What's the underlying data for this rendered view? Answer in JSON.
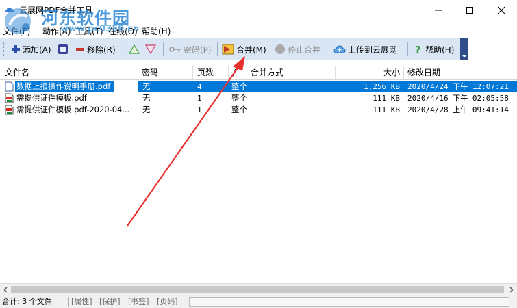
{
  "window": {
    "title": "云展网PDF合并工具"
  },
  "watermark": {
    "text": "河东软件园",
    "url": "www.pc0359.cn"
  },
  "menu": {
    "items": [
      "文件(F)",
      "动作(A)",
      "工具(T)",
      "在线(O)",
      "帮助(H)"
    ]
  },
  "toolbar": {
    "add": "添加(A)",
    "remove": "移除(R)",
    "password": "密码(P)",
    "merge": "合并(M)",
    "stop": "停止合并",
    "upload": "上传到云展网",
    "help": "帮助(H)"
  },
  "columns": {
    "name": "文件名",
    "password": "密码",
    "pages": "页数",
    "sort": "/",
    "mode": "合并方式",
    "size": "大小",
    "date": "修改日期"
  },
  "files": [
    {
      "name": "数据上报操作说明手册.pdf",
      "password": "无",
      "pages": "4",
      "mode": "整个",
      "size": "1,256 KB",
      "date": "2020/4/24 下午 12:07:21",
      "selected": true
    },
    {
      "name": "需提供证件模板.pdf",
      "password": "无",
      "pages": "1",
      "mode": "整个",
      "size": "111 KB",
      "date": "2020/4/16 下午 02:05:58",
      "selected": false
    },
    {
      "name": "需提供证件模板.pdf-2020-04...",
      "password": "无",
      "pages": "1",
      "mode": "整个",
      "size": "111 KB",
      "date": "2020/4/28 上午 09:41:14",
      "selected": false
    }
  ],
  "status": {
    "total": "合计: 3 个文件",
    "attr": "[属性]",
    "protect": "[保护]",
    "bookmark": "[书签]",
    "pagecode": "[页码]"
  },
  "colors": {
    "selection": "#0078d7",
    "toolbar_bg": "#dbe6f4",
    "annotation_arrow": "#e8312f",
    "watermark": "#2f8ad6"
  }
}
